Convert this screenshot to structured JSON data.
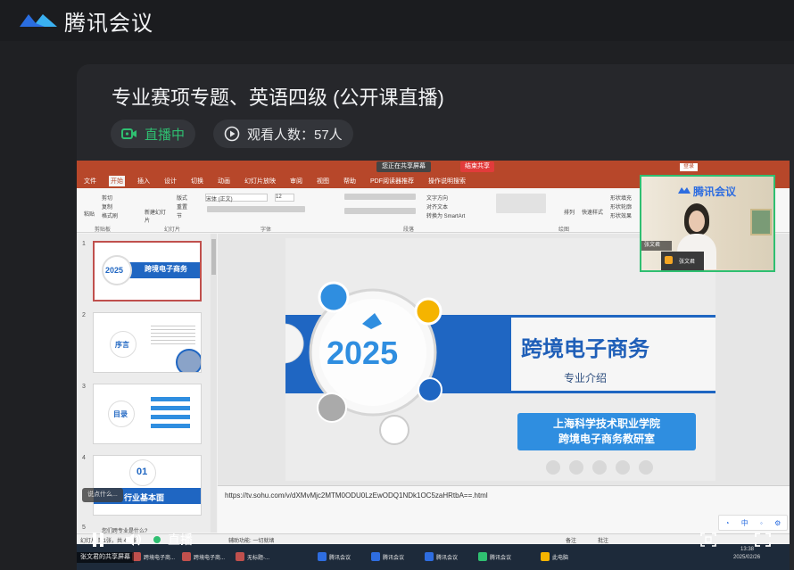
{
  "app": {
    "brand": "腾讯会议"
  },
  "meeting": {
    "title": "专业赛项专题、英语四级 (公开课直播)",
    "live_label": "直播中",
    "viewers_label": "观看人数：57人"
  },
  "ppt": {
    "share_label": "您正在共享屏幕",
    "stop_share_label": "结束共享",
    "login_label": "登录",
    "tabs": [
      "文件",
      "开始",
      "插入",
      "设计",
      "切换",
      "动画",
      "幻灯片放映",
      "审阅",
      "视图",
      "帮助",
      "PDF阅读器推荐",
      "操作说明搜索"
    ],
    "active_tab": "开始",
    "ribbon_groups": [
      "剪贴板",
      "幻灯片",
      "字体",
      "段落",
      "绘图"
    ],
    "ribbon_labels": {
      "paste": "粘贴",
      "new_slide": "新建幻灯片",
      "font_name": "宋体 (正文)",
      "font_size": "12",
      "cut": "剪切",
      "copy": "复制",
      "format_painter": "格式刷",
      "layout": "版式",
      "reset": "重置",
      "section": "节",
      "text_direction": "文字方向",
      "align_text": "对齐文本",
      "smartart": "转换为 SmartArt",
      "arrange": "排列",
      "quick_styles": "快速样式",
      "shape_fill": "形状填充",
      "shape_outline": "形状轮廓",
      "shape_effects": "形状效果"
    },
    "thumbnails": [
      {
        "num": "1",
        "title": "跨境电子商务",
        "year": "2025"
      },
      {
        "num": "2",
        "title": "序言"
      },
      {
        "num": "3",
        "title": "目录"
      },
      {
        "num": "4",
        "title": "行业基本面",
        "badge": "01"
      },
      {
        "num": "5"
      }
    ],
    "slide": {
      "year": "2025",
      "title": "跨境电子商务",
      "subtitle": "专业介绍",
      "school_line1": "上海科学技术职业学院",
      "school_line2": "跨境电子商务教研室"
    },
    "notes_url": "https://tv.sohu.com/v/dXMvMjc2MTM0ODU0LzEwODQ1NDk1OC5zaHRtbA==.html",
    "status_left": "幻灯片 第1张，共 41 张",
    "status_mid": "辅助功能: 一切就绪",
    "status_notes": "备注",
    "status_comment": "批注",
    "float_hint": "说点什么...",
    "bottom_badge": "张文君的共享屏幕",
    "question_line": "您们跨专业是什么?"
  },
  "webcam": {
    "logo": "腾讯会议",
    "name": "张文君",
    "self_name": "张文君"
  },
  "controls": {
    "live_label": "直播"
  },
  "taskbar": {
    "items": [
      "跨境电子商...",
      "跨境电子商...",
      "无标题-...",
      "腾讯会议",
      "腾讯会议",
      "腾讯会议",
      "腾讯会议",
      "此电脑"
    ],
    "time": "13:38",
    "date": "2025/02/26",
    "ime": "中"
  },
  "colors": {
    "accent_green": "#2fbf71",
    "ppt_red": "#b7472a",
    "slide_blue": "#1f66c2"
  }
}
